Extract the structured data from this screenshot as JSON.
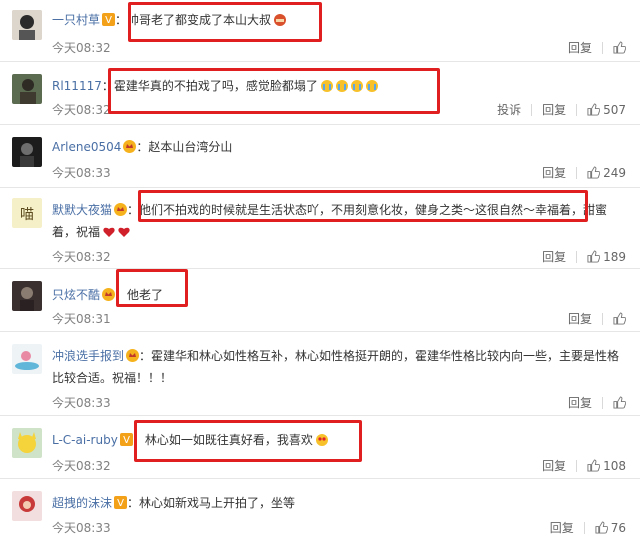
{
  "comments": [
    {
      "nick": "一只村草",
      "badge": "verified",
      "text": "帅哥老了都变成了本山大叔",
      "time": "今天08:32",
      "reply": "回复"
    },
    {
      "nick": "Rl11117",
      "text": "霍建华真的不拍戏了吗，感觉脸都塌了",
      "time": "今天08:32",
      "report": "投诉",
      "reply": "回复",
      "likes": "507"
    },
    {
      "nick": "Arlene0504",
      "badge": "member",
      "text": "赵本山台湾分山",
      "time": "今天08:33",
      "reply": "回复",
      "likes": "249"
    },
    {
      "nick": "默默大夜猫",
      "badge": "member",
      "text": "他们不拍戏的时候就是生活状态吖，不用刻意化妆，健身之类～这很自然～幸福着，甜蜜",
      "text2": "着，祝福",
      "time": "今天08:32",
      "reply": "回复",
      "likes": "189"
    },
    {
      "nick": "只炫不酷",
      "badge": "member",
      "text": "他老了",
      "time": "今天08:31",
      "reply": "回复"
    },
    {
      "nick": "冲浪选手报到",
      "badge": "member",
      "text": "霍建华和林心如性格互补，林心如性格挺开朗的，霍建华性格比较内向一些，主要是性格",
      "text2": "比较合适。祝福！！！",
      "time": "今天08:33",
      "reply": "回复"
    },
    {
      "nick": "L-C-ai-ruby",
      "badge": "verified",
      "text": "林心如一如既往真好看，我喜欢",
      "time": "今天08:32",
      "reply": "回复",
      "likes": "108"
    },
    {
      "nick": "超拽的沫沫",
      "badge": "verified",
      "text": "林心如新戏马上开拍了，坐等",
      "time": "今天08:33",
      "reply": "回复",
      "likes": "76"
    }
  ],
  "colors": {
    "nick": "#4a6fa5",
    "highlight": "#e02020",
    "verified": "#f4a11a",
    "member": "#f6b21c"
  }
}
